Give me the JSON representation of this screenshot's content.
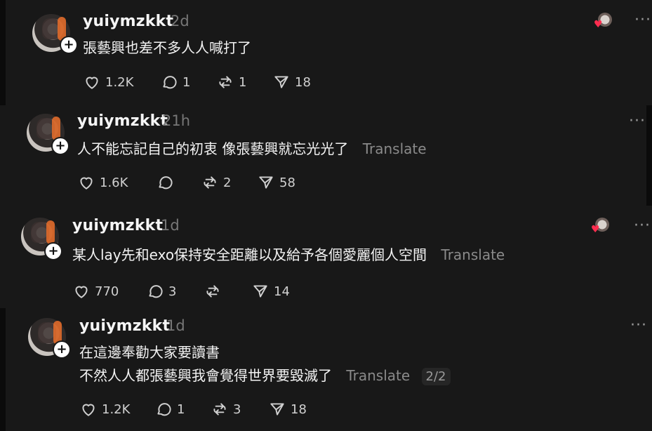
{
  "posts": [
    {
      "username": "yuiymzkkt",
      "time": "2d",
      "lines": [
        "張藝興也差不多人人喊打了"
      ],
      "translate": "",
      "page_badge": "",
      "likes": "1.2K",
      "replies": "1",
      "reposts": "1",
      "shares": "18",
      "has_reaction": true
    },
    {
      "username": "yuiymzkkt",
      "time": "21h",
      "lines": [
        "人不能忘記自己的初衷 像張藝興就忘光光了"
      ],
      "translate": "Translate",
      "page_badge": "",
      "likes": "1.6K",
      "replies": "",
      "reposts": "2",
      "shares": "58",
      "has_reaction": false
    },
    {
      "username": "yuiymzkkt",
      "time": "1d",
      "lines": [
        "某人lay先和exo保持安全距離以及給予各個愛麗個人空間"
      ],
      "translate": "Translate",
      "page_badge": "",
      "likes": "770",
      "replies": "3",
      "reposts": "",
      "shares": "14",
      "has_reaction": true
    },
    {
      "username": "yuiymzkkt",
      "time": "1d",
      "lines": [
        "在這邊奉勸大家要讀書",
        "不然人人都張藝興我會覺得世界要毀滅了"
      ],
      "translate": "Translate",
      "page_badge": "2/2",
      "likes": "1.2K",
      "replies": "1",
      "reposts": "3",
      "shares": "18",
      "has_reaction": false
    }
  ],
  "icons": {
    "like": "heart-icon",
    "reply": "comment-icon",
    "repost": "repost-icon",
    "share": "send-icon",
    "more": "more-dots-icon",
    "follow": "plus-icon"
  },
  "colors": {
    "background": "#0b0b0b",
    "panel": "#181818",
    "muted": "#777777",
    "reaction_heart": "#ff2d4f"
  }
}
